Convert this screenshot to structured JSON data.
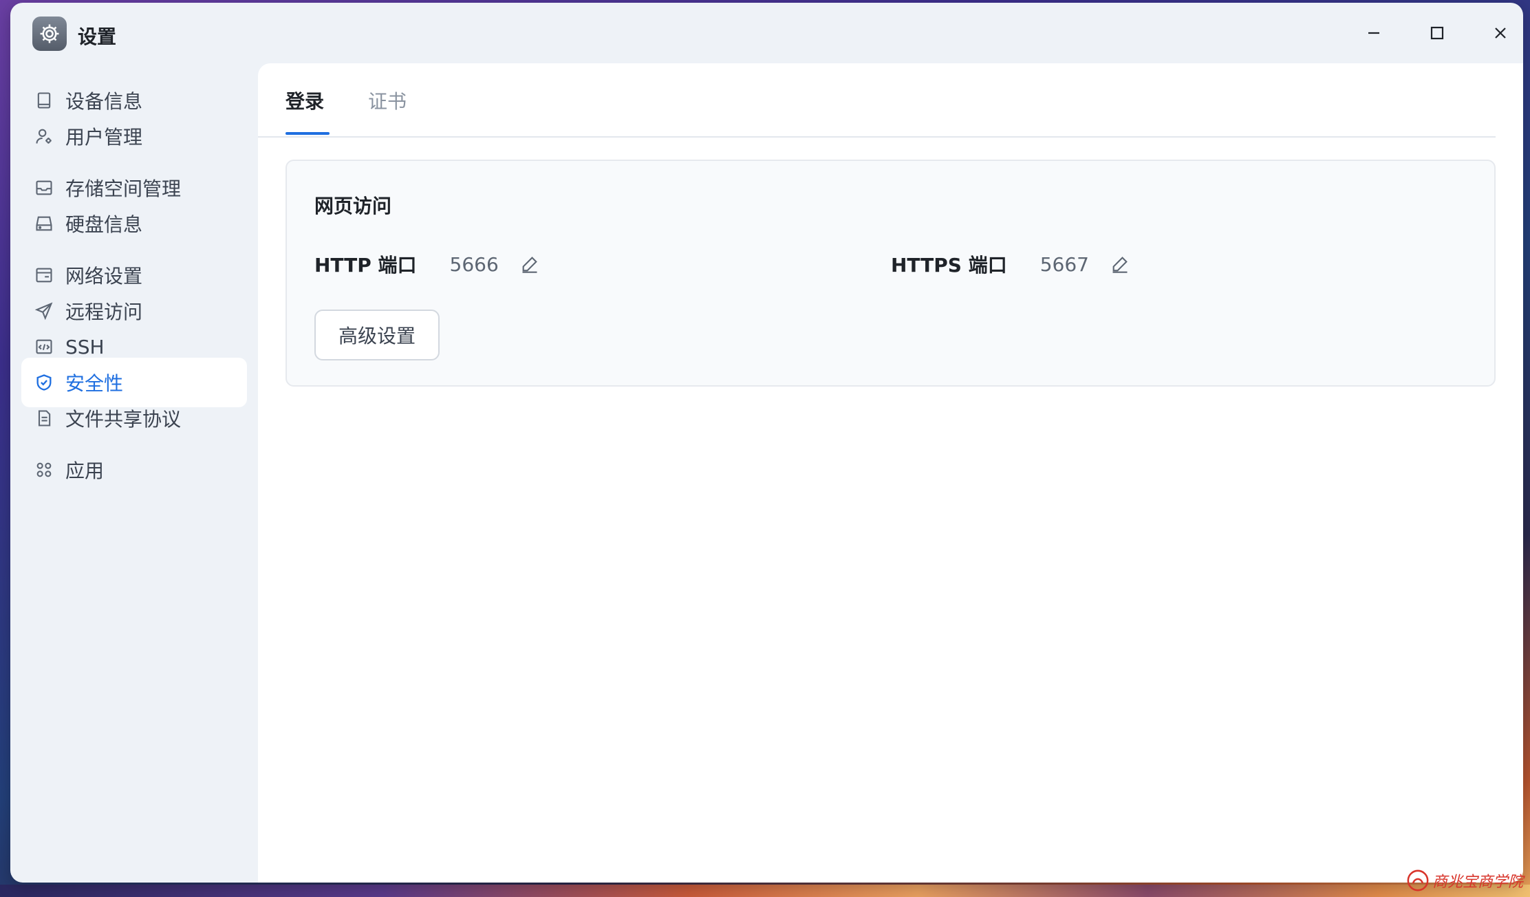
{
  "window": {
    "title": "设置"
  },
  "sidebar": {
    "items": [
      {
        "label": "设备信息",
        "icon": "device-icon"
      },
      {
        "label": "用户管理",
        "icon": "user-gear-icon"
      },
      {
        "label": "存储空间管理",
        "icon": "storage-icon"
      },
      {
        "label": "硬盘信息",
        "icon": "disk-icon"
      },
      {
        "label": "网络设置",
        "icon": "network-icon"
      },
      {
        "label": "远程访问",
        "icon": "send-icon"
      },
      {
        "label": "SSH",
        "icon": "code-icon"
      },
      {
        "label": "安全性",
        "icon": "shield-check-icon",
        "active": true
      },
      {
        "label": "文件共享协议",
        "icon": "document-icon"
      },
      {
        "label": "应用",
        "icon": "apps-icon"
      }
    ]
  },
  "tabs": [
    {
      "label": "登录",
      "active": true
    },
    {
      "label": "证书",
      "active": false
    }
  ],
  "web_access": {
    "title": "网页访问",
    "http_label": "HTTP 端口",
    "http_port": "5666",
    "https_label": "HTTPS 端口",
    "https_port": "5667",
    "advanced_button": "高级设置"
  },
  "watermark": {
    "text": "商兆宝商学院"
  },
  "colors": {
    "accent": "#1f6fe0",
    "sidebar_bg": "#eef2f7",
    "text_primary": "#1f2329",
    "text_secondary": "#5d6673"
  }
}
